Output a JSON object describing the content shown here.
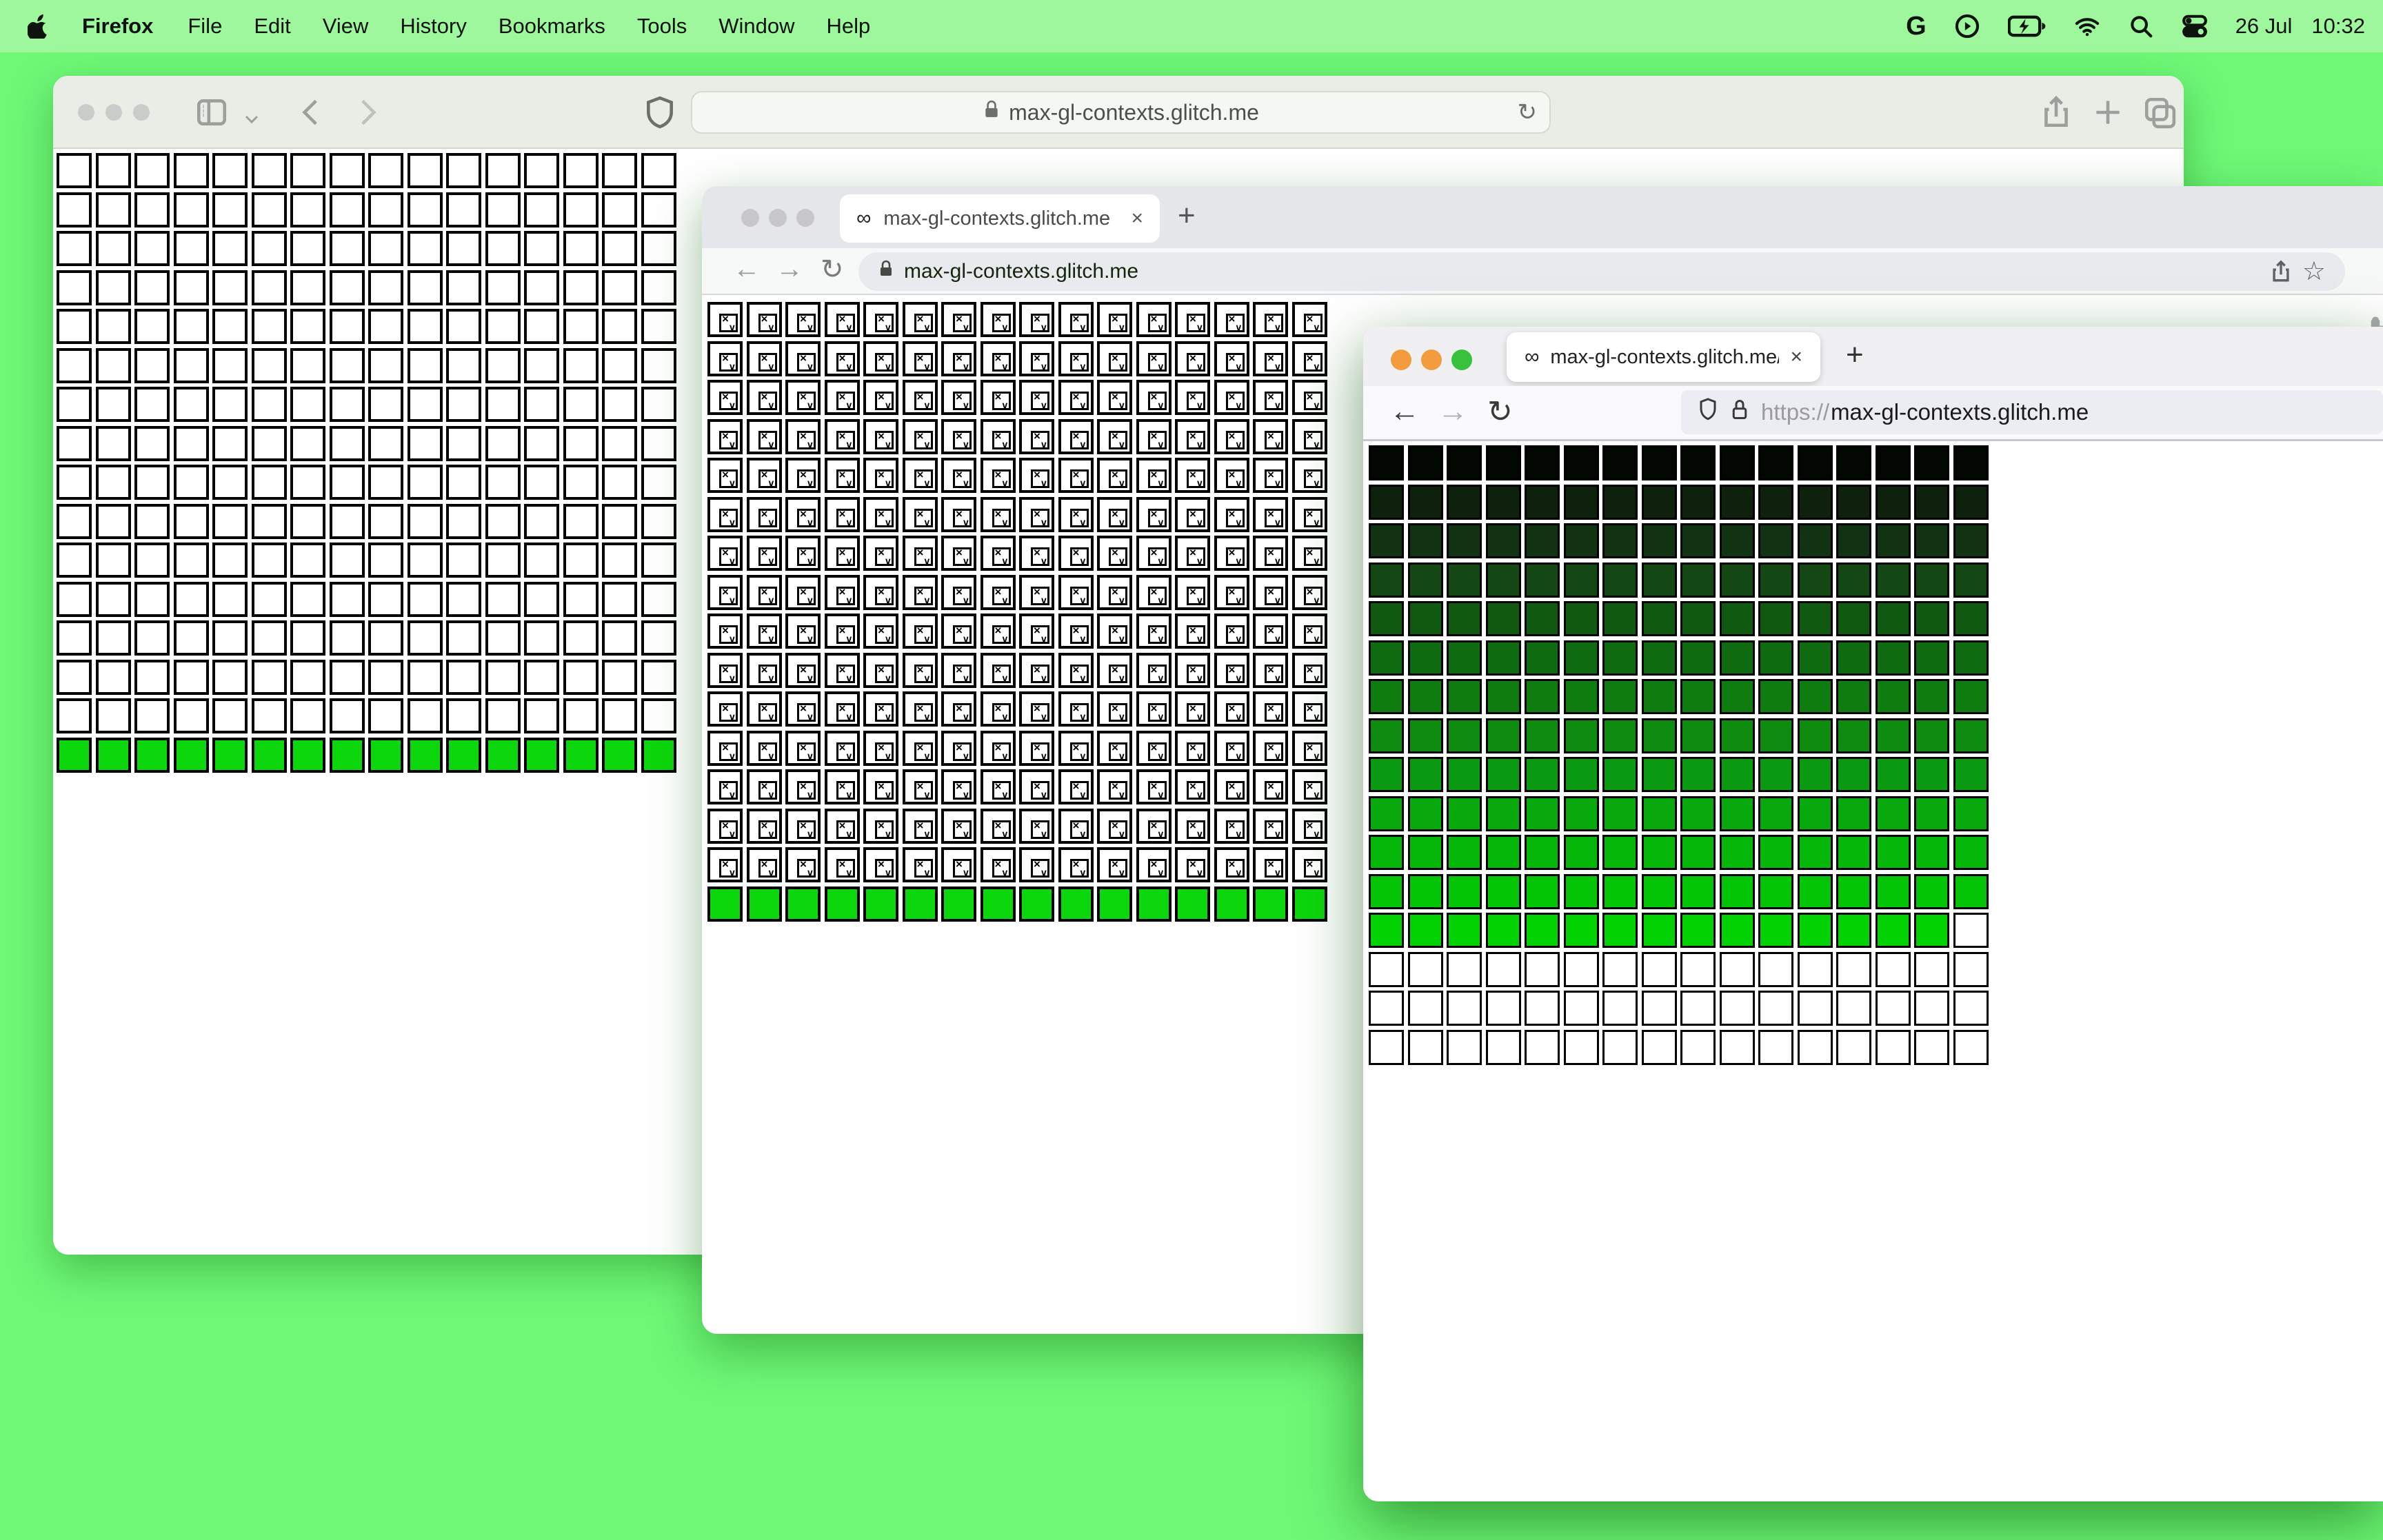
{
  "menu_bar": {
    "apple_icon": "apple-logo",
    "items": [
      "Firefox",
      "File",
      "Edit",
      "View",
      "History",
      "Bookmarks",
      "Tools",
      "Window",
      "Help"
    ],
    "status": {
      "date": "26 Jul",
      "time": "10:32"
    },
    "status_icons": [
      "google-icon",
      "play-icon",
      "battery-icon",
      "wifi-icon",
      "search-icon",
      "control-center-icon"
    ]
  },
  "colors": {
    "desktop": "#6ef876",
    "menubar": "#9ff79d",
    "green_row": "#0cd60c",
    "traffic_inactive": "#c8cbc8",
    "ff_close": "#f39c3f",
    "ff_min": "#f39c3f",
    "ff_zoom": "#36c33b"
  },
  "safari": {
    "url": "max-gl-contexts.glitch.me",
    "reload_glyph": "↻",
    "grid": {
      "cols": 16,
      "rows": [
        {
          "cell": "empty",
          "repeat": 15
        },
        {
          "cell": "fill",
          "color": "#0cd60c",
          "repeat": 1
        }
      ]
    }
  },
  "chrome": {
    "tab_favicon": "∞",
    "tab_title": "max-gl-contexts.glitch.me",
    "tab_close": "×",
    "new_tab": "+",
    "back": "←",
    "forward": "→",
    "reload": "↻",
    "url": "max-gl-contexts.glitch.me",
    "star": "☆",
    "grid": {
      "cols": 16,
      "rows": [
        {
          "cell": "broken",
          "repeat": 15
        },
        {
          "cell": "fill",
          "color": "#0cd60c",
          "repeat": 1
        }
      ]
    }
  },
  "firefox": {
    "tab_favicon": "∞",
    "tab_title": "max-gl-contexts.glitch.me/",
    "tab_close": "×",
    "new_tab": "+",
    "back": "←",
    "forward": "→",
    "reload": "↻",
    "url_scheme": "https://",
    "url_host": "max-gl-contexts.glitch.me",
    "grid": {
      "cols": 16,
      "rows": [
        {
          "cell": "fill",
          "color": "#020702",
          "repeat": 1
        },
        {
          "cell": "fill",
          "color": "#0d210d",
          "repeat": 1
        },
        {
          "cell": "fill",
          "color": "#113311",
          "repeat": 1
        },
        {
          "cell": "fill",
          "color": "#134713",
          "repeat": 1
        },
        {
          "cell": "fill",
          "color": "#105910",
          "repeat": 1
        },
        {
          "cell": "fill",
          "color": "#0f6b0f",
          "repeat": 1
        },
        {
          "cell": "fill",
          "color": "#0e7c0e",
          "repeat": 1
        },
        {
          "cell": "fill",
          "color": "#0d8c10",
          "repeat": 1
        },
        {
          "cell": "fill",
          "color": "#0a9a11",
          "repeat": 1
        },
        {
          "cell": "fill",
          "color": "#07a90d",
          "repeat": 1
        },
        {
          "cell": "fill",
          "color": "#05b708",
          "repeat": 1
        },
        {
          "cell": "fill",
          "color": "#03c405",
          "repeat": 1
        },
        {
          "cell": "fill",
          "color": "#02d102",
          "repeat": 1,
          "empty_last": 1
        },
        {
          "cell": "empty",
          "repeat": 3
        }
      ]
    },
    "broken_x": "×",
    "broken_v": "∨"
  }
}
